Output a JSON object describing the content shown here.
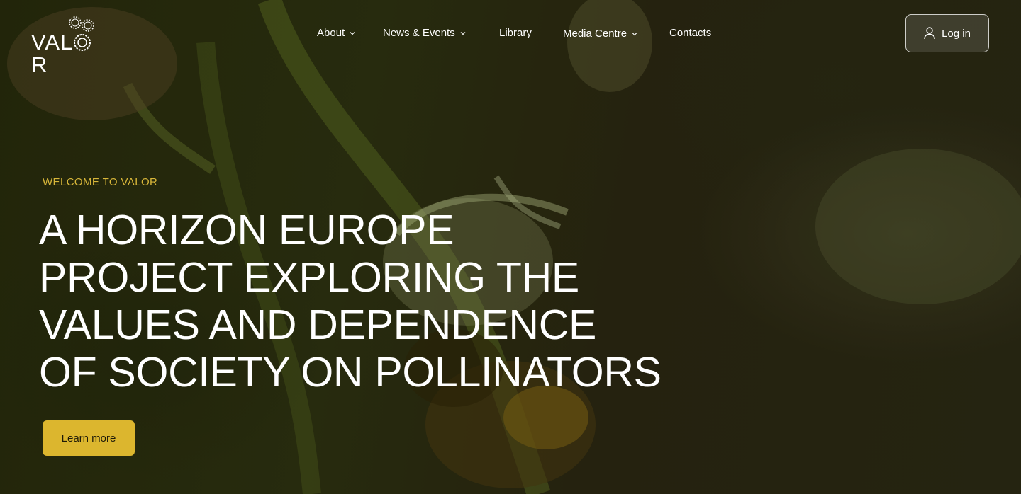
{
  "brand": {
    "logo_text": "VAL",
    "logo_text_end": "R"
  },
  "nav": {
    "items": [
      {
        "label": "About",
        "has_dropdown": true
      },
      {
        "label": "News & Events",
        "has_dropdown": true
      },
      {
        "label": "Library",
        "has_dropdown": false
      },
      {
        "label": "Media Centre",
        "has_dropdown": true
      },
      {
        "label": "Contacts",
        "has_dropdown": false
      }
    ],
    "login_label": "Log in",
    "login_icon": "user-icon"
  },
  "hero": {
    "eyebrow": "WELCOME TO VALOR",
    "headline_lines": [
      "A HORIZON EUROPE",
      "PROJECT EXPLORING THE",
      "VALUES AND DEPENDENCE",
      "OF SOCIETY ON POLLINATORS"
    ],
    "cta_label": "Learn more"
  },
  "colors": {
    "accent": "#dcb62e",
    "eyebrow": "#d9b73a",
    "background": "#2b2c12"
  }
}
